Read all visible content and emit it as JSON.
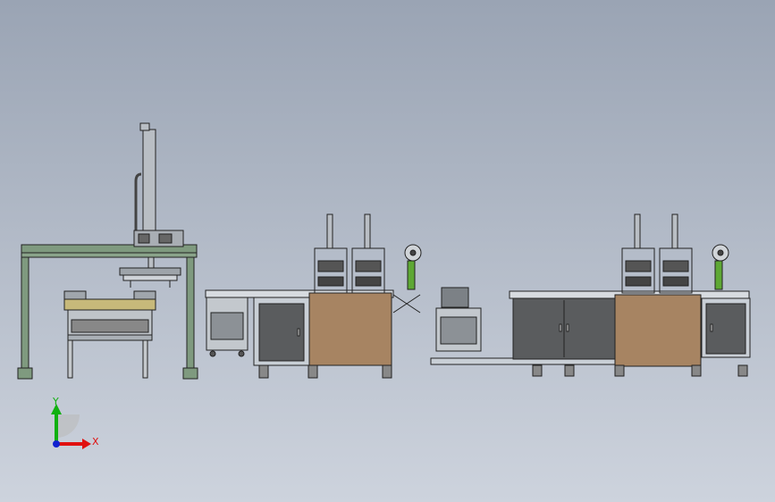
{
  "axis_triad": {
    "x_label": "X",
    "y_label": "Y"
  },
  "colors": {
    "background_top": "#9aa4b4",
    "background_bottom": "#cdd3dd",
    "frame_green": "#7f9a7f",
    "cabinet_brown": "#a78462",
    "cabinet_gray": "#5a5c5e",
    "panel_light": "#c9cfd6",
    "steel": "#b9bec4",
    "line_dark": "#222222",
    "label_green": "#5ea834",
    "axis_x": "#e01010",
    "axis_y": "#10b010",
    "axis_z": "#1020d0"
  }
}
